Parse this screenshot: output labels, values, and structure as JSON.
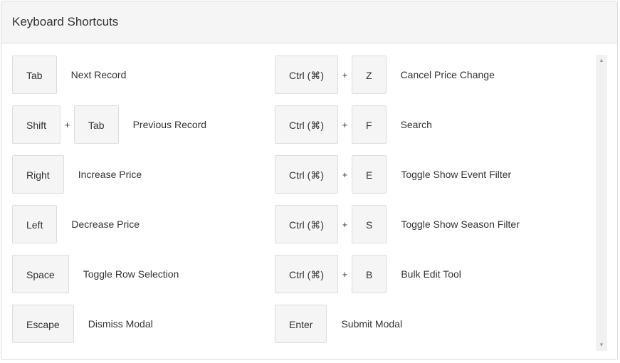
{
  "panel": {
    "title": "Keyboard Shortcuts"
  },
  "shortcuts_left": [
    {
      "keys": [
        "Tab"
      ],
      "label": "Next Record"
    },
    {
      "keys": [
        "Shift",
        "Tab"
      ],
      "label": "Previous Record"
    },
    {
      "keys": [
        "Right"
      ],
      "label": "Increase Price"
    },
    {
      "keys": [
        "Left"
      ],
      "label": "Decrease Price"
    },
    {
      "keys": [
        "Space"
      ],
      "label": "Toggle Row Selection"
    },
    {
      "keys": [
        "Escape"
      ],
      "label": "Dismiss Modal"
    }
  ],
  "shortcuts_right": [
    {
      "keys": [
        "Ctrl (⌘)",
        "Z"
      ],
      "label": "Cancel Price Change"
    },
    {
      "keys": [
        "Ctrl (⌘)",
        "F"
      ],
      "label": "Search"
    },
    {
      "keys": [
        "Ctrl (⌘)",
        "E"
      ],
      "label": "Toggle Show Event Filter"
    },
    {
      "keys": [
        "Ctrl (⌘)",
        "S"
      ],
      "label": "Toggle Show Season Filter"
    },
    {
      "keys": [
        "Ctrl (⌘)",
        "B"
      ],
      "label": "Bulk Edit Tool"
    },
    {
      "keys": [
        "Enter"
      ],
      "label": "Submit Modal"
    }
  ],
  "key_separator": "+",
  "scrollbar": {
    "up_icon": "triangle-up-icon",
    "down_icon": "triangle-down-icon",
    "up_glyph": "▲",
    "down_glyph": "▼"
  }
}
